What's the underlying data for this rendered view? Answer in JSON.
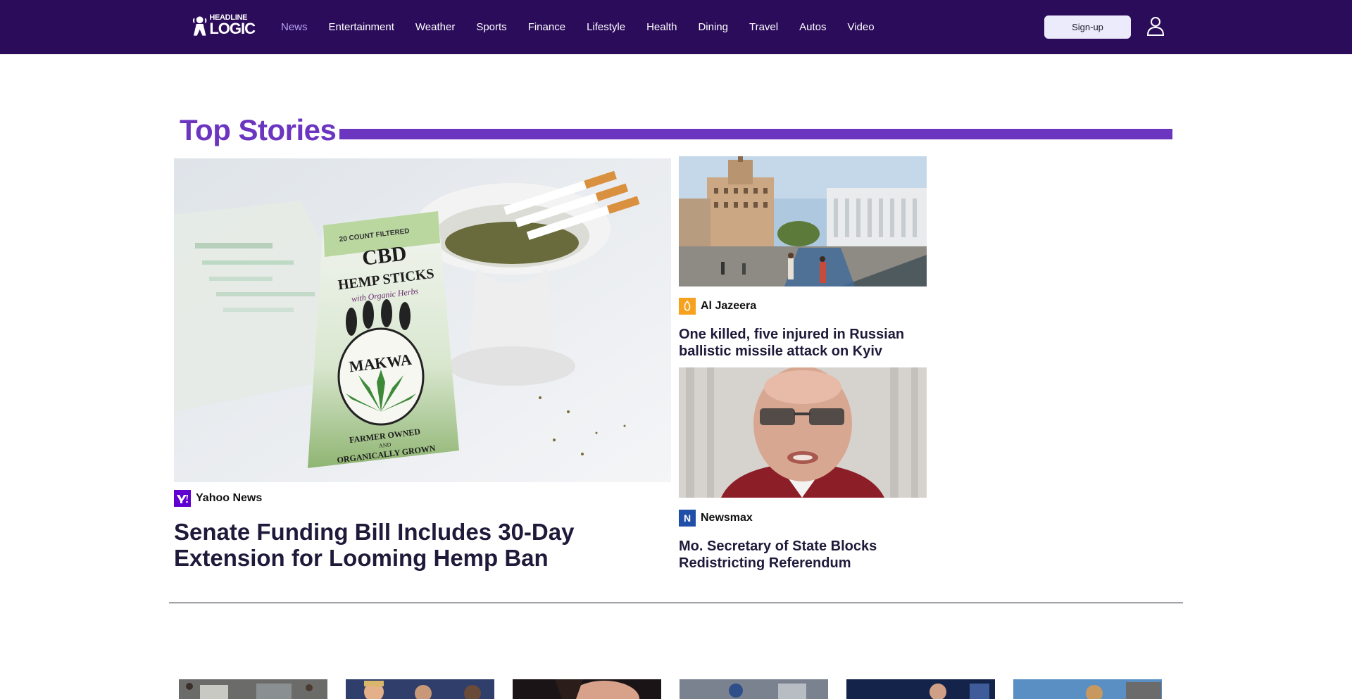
{
  "header": {
    "logo": {
      "line1": "HEADLINE",
      "line2": "LOGIC"
    },
    "nav": [
      "News",
      "Entertainment",
      "Weather",
      "Sports",
      "Finance",
      "Lifestyle",
      "Health",
      "Dining",
      "Travel",
      "Autos",
      "Video"
    ],
    "active_nav": "News",
    "signup_label": "Sign-up",
    "user_icon": "user-icon"
  },
  "top_stories": {
    "title": "Top Stories",
    "accent_color": "#6c35c0",
    "hero": {
      "source": "Yahoo News",
      "source_color": "#6001d2",
      "headline": "Senate Funding Bill Includes 30-Day Extension for Looming Hemp Ban",
      "image": {
        "box_line1": "20 COUNT FILTERED",
        "box_line2": "CBD",
        "box_line3": "HEMP STICKS",
        "box_line4": "with Organic Herbs",
        "brand": "MAKWA",
        "footer1": "FARMER OWNED",
        "footer2": "AND",
        "footer3": "ORGANICALLY GROWN"
      }
    },
    "side": [
      {
        "source": "Al Jazeera",
        "source_color": "#f6a21e",
        "headline": "One killed, five injured in Russian ballistic missile attack on Kyiv"
      },
      {
        "source": "Newsmax",
        "source_color": "#1f4fa8",
        "source_letter": "N",
        "headline": "Mo. Secretary of State Blocks Redistricting Referendum"
      }
    ]
  }
}
